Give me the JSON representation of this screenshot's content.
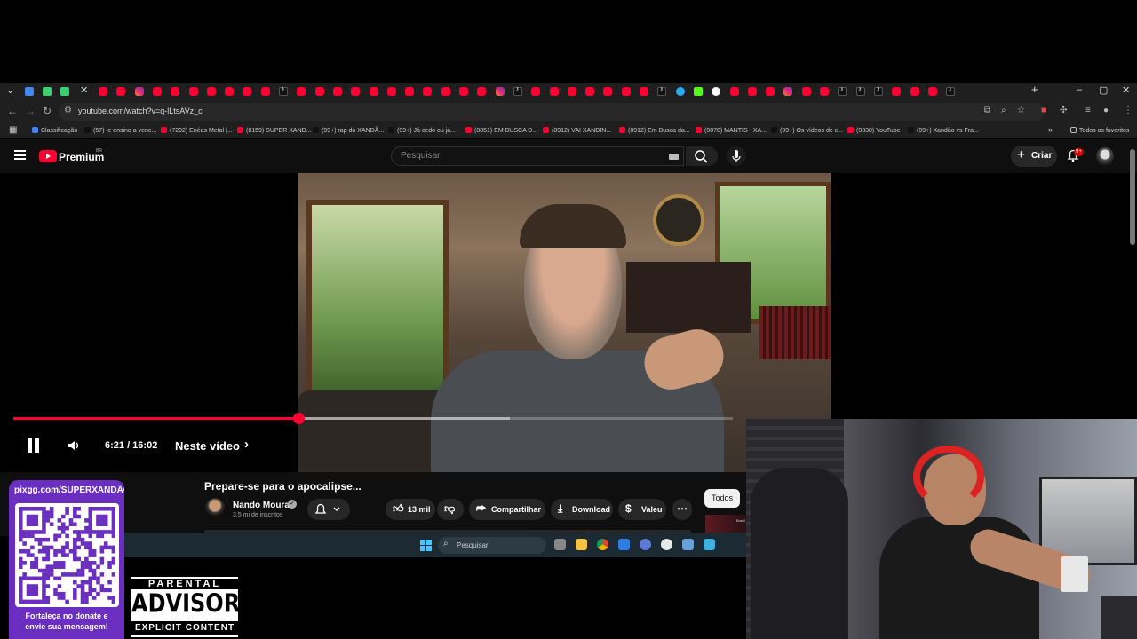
{
  "browser": {
    "tab_icons": [
      "yt",
      "yt",
      "ig",
      "yt",
      "yt",
      "yt",
      "yt",
      "yt",
      "yt",
      "yt",
      "tt",
      "yt",
      "yt",
      "yt",
      "yt",
      "yt",
      "yt",
      "yt",
      "yt",
      "yt",
      "yt",
      "yt",
      "ig",
      "tt",
      "yt",
      "yt",
      "yt",
      "yt",
      "yt",
      "yt",
      "yt",
      "tt",
      "tg",
      "kk",
      "gg",
      "yt",
      "yt",
      "yt",
      "ig",
      "yt",
      "yt",
      "tt",
      "tt",
      "tt",
      "yt",
      "yt",
      "yt",
      "tt"
    ],
    "new_tab_label": "+",
    "minimize_label": "–",
    "maximize_label": "▢",
    "close_label": "✕",
    "url": "youtube.com/watch?v=q-lLtsAVz_c",
    "bookmarks": [
      {
        "label": "Classificação",
        "color": "#4285f4"
      },
      {
        "label": "(57) Ie ensino a venc...",
        "color": "#111111"
      },
      {
        "label": "(7292) Enéas Metal |...",
        "color": "#ff0033"
      },
      {
        "label": "(8159) SUPER XAND...",
        "color": "#ff0033"
      },
      {
        "label": "(99+) rap do XANDÃ...",
        "color": "#111111"
      },
      {
        "label": "(99+) Já cedo ou já...",
        "color": "#111111"
      },
      {
        "label": "(8851) EM BUSCA D...",
        "color": "#ff0033"
      },
      {
        "label": "(8912) VAI XANDIN...",
        "color": "#ff0033"
      },
      {
        "label": "(8912) Em Busca da...",
        "color": "#ff0033"
      },
      {
        "label": "(9078) MANTIS - XA...",
        "color": "#ff0033"
      },
      {
        "label": "(99+) Os vídeos de c...",
        "color": "#111111"
      },
      {
        "label": "(9338) YouTube",
        "color": "#ff0033"
      },
      {
        "label": "(99+) Xandão vs Fra...",
        "color": "#111111"
      }
    ],
    "bookmarks_more": "»",
    "all_bookmarks": "Todos os favoritos"
  },
  "youtube": {
    "brand": "Premium",
    "region": "BR",
    "search_placeholder": "Pesquisar",
    "create_label": "Criar",
    "notifications_badge": "9+"
  },
  "player": {
    "current_time": "6:21",
    "duration": "16:02",
    "time_display": "6:21 / 16:02",
    "progress_fraction": 0.396,
    "buffer_fraction": 0.69,
    "chapter_label": "Neste vídeo"
  },
  "video": {
    "title": "Prepare-se para o apocalipse...",
    "channel_name": "Nando Moura",
    "subscribers": "3,5 mi de inscritos",
    "likes": "13 mil",
    "share_label": "Compartilhar",
    "download_label": "Download",
    "thanks_label": "Valeu",
    "filter_chip": "Todos",
    "related_thumb_label": "Brasil"
  },
  "taskbar": {
    "search_placeholder": "Pesquisar"
  },
  "overlay": {
    "donate_url": "pixgg.com/SUPERXANDÃO",
    "donate_message_line1": "Fortaleça no donate e",
    "donate_message_line2": "envie sua mensagem!",
    "advisory_top": "PARENTAL",
    "advisory_mid": "ADVISORY",
    "advisory_bottom": "EXPLICIT CONTENT"
  },
  "colors": {
    "youtube_red": "#ff0033",
    "donate_purple": "#6a2fc0",
    "background": "#0f0f0f"
  }
}
